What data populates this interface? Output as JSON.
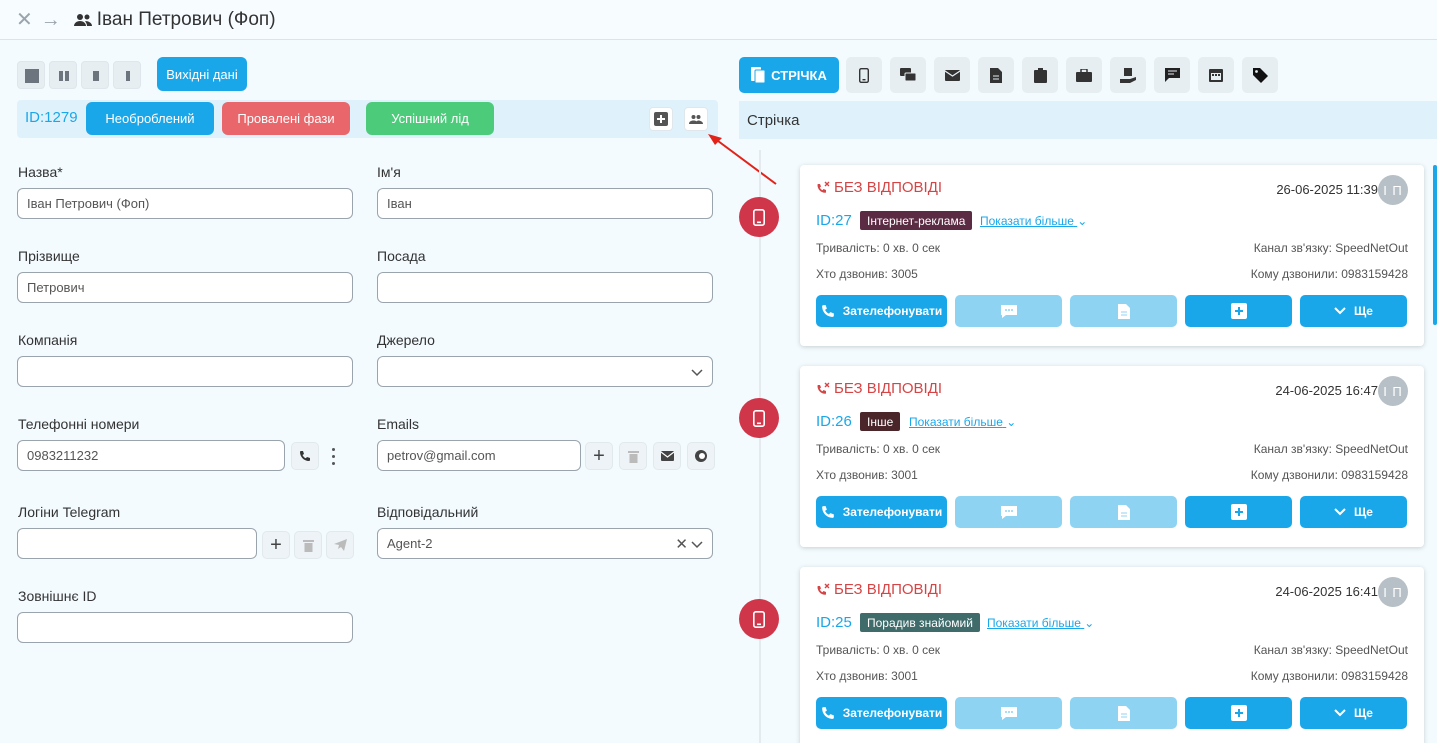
{
  "header": {
    "title": "Іван Петрович (Фоп)"
  },
  "left": {
    "output_button": "Вихідні дані",
    "lead_id": "ID:1279",
    "phases": [
      "Необроблений",
      "Провалені фази",
      "Успішний лід"
    ],
    "fields": {
      "name_label": "Назва*",
      "name_value": "Іван Петрович (Фоп)",
      "first_label": "Ім'я",
      "first_value": "Іван",
      "last_label": "Прізвище",
      "last_value": "Петрович",
      "position_label": "Посада",
      "position_value": "",
      "company_label": "Компанія",
      "company_value": "",
      "source_label": "Джерело",
      "source_value": "",
      "phones_label": "Телефонні номери",
      "phone_value": "0983211232",
      "emails_label": "Emails",
      "email_value": "petrov@gmail.com",
      "telegram_label": "Логіни Telegram",
      "telegram_value": "",
      "responsible_label": "Відповідальний",
      "responsible_value": "Agent-2",
      "external_label": "Зовнішнє ID",
      "external_value": ""
    }
  },
  "right": {
    "active_tab": "СТРІЧКА",
    "feed_title": "Стрічка",
    "cards": [
      {
        "status": "БЕЗ ВІДПОВІДІ",
        "date": "26-06-2025 11:39",
        "avatar": "І П",
        "id": "ID:27",
        "tag": "Інтернет-реклама",
        "tag_color": "#5b2b43",
        "more": "Показати більше",
        "duration": "Тривалість: 0 хв. 0 сек",
        "channel": "Канал зв'язку: SpeedNetOut",
        "caller": "Хто дзвонив: 3005",
        "callee": "Кому дзвонили: 0983159428",
        "call_btn": "Зателефонувати",
        "more_btn": "Ще"
      },
      {
        "status": "БЕЗ ВІДПОВІДІ",
        "date": "24-06-2025 16:47",
        "avatar": "І П",
        "id": "ID:26",
        "tag": "Інше",
        "tag_color": "#4a2529",
        "more": "Показати більше",
        "duration": "Тривалість: 0 хв. 0 сек",
        "channel": "Канал зв'язку: SpeedNetOut",
        "caller": "Хто дзвонив: 3001",
        "callee": "Кому дзвонили: 0983159428",
        "call_btn": "Зателефонувати",
        "more_btn": "Ще"
      },
      {
        "status": "БЕЗ ВІДПОВІДІ",
        "date": "24-06-2025 16:41",
        "avatar": "І П",
        "id": "ID:25",
        "tag": "Порадив знайомий",
        "tag_color": "#3f6b6a",
        "more": "Показати більше",
        "duration": "Тривалість: 0 хв. 0 сек",
        "channel": "Канал зв'язку: SpeedNetOut",
        "caller": "Хто дзвонив: 3001",
        "callee": "Кому дзвонили: 0983159428",
        "call_btn": "Зателефонувати",
        "more_btn": "Ще"
      }
    ]
  },
  "colors": {
    "accent": "#1aa7ea",
    "danger": "#d0364a",
    "phase_new": "#1aa7ea",
    "phase_failed": "#e9666b",
    "phase_success": "#4ccb7a"
  }
}
